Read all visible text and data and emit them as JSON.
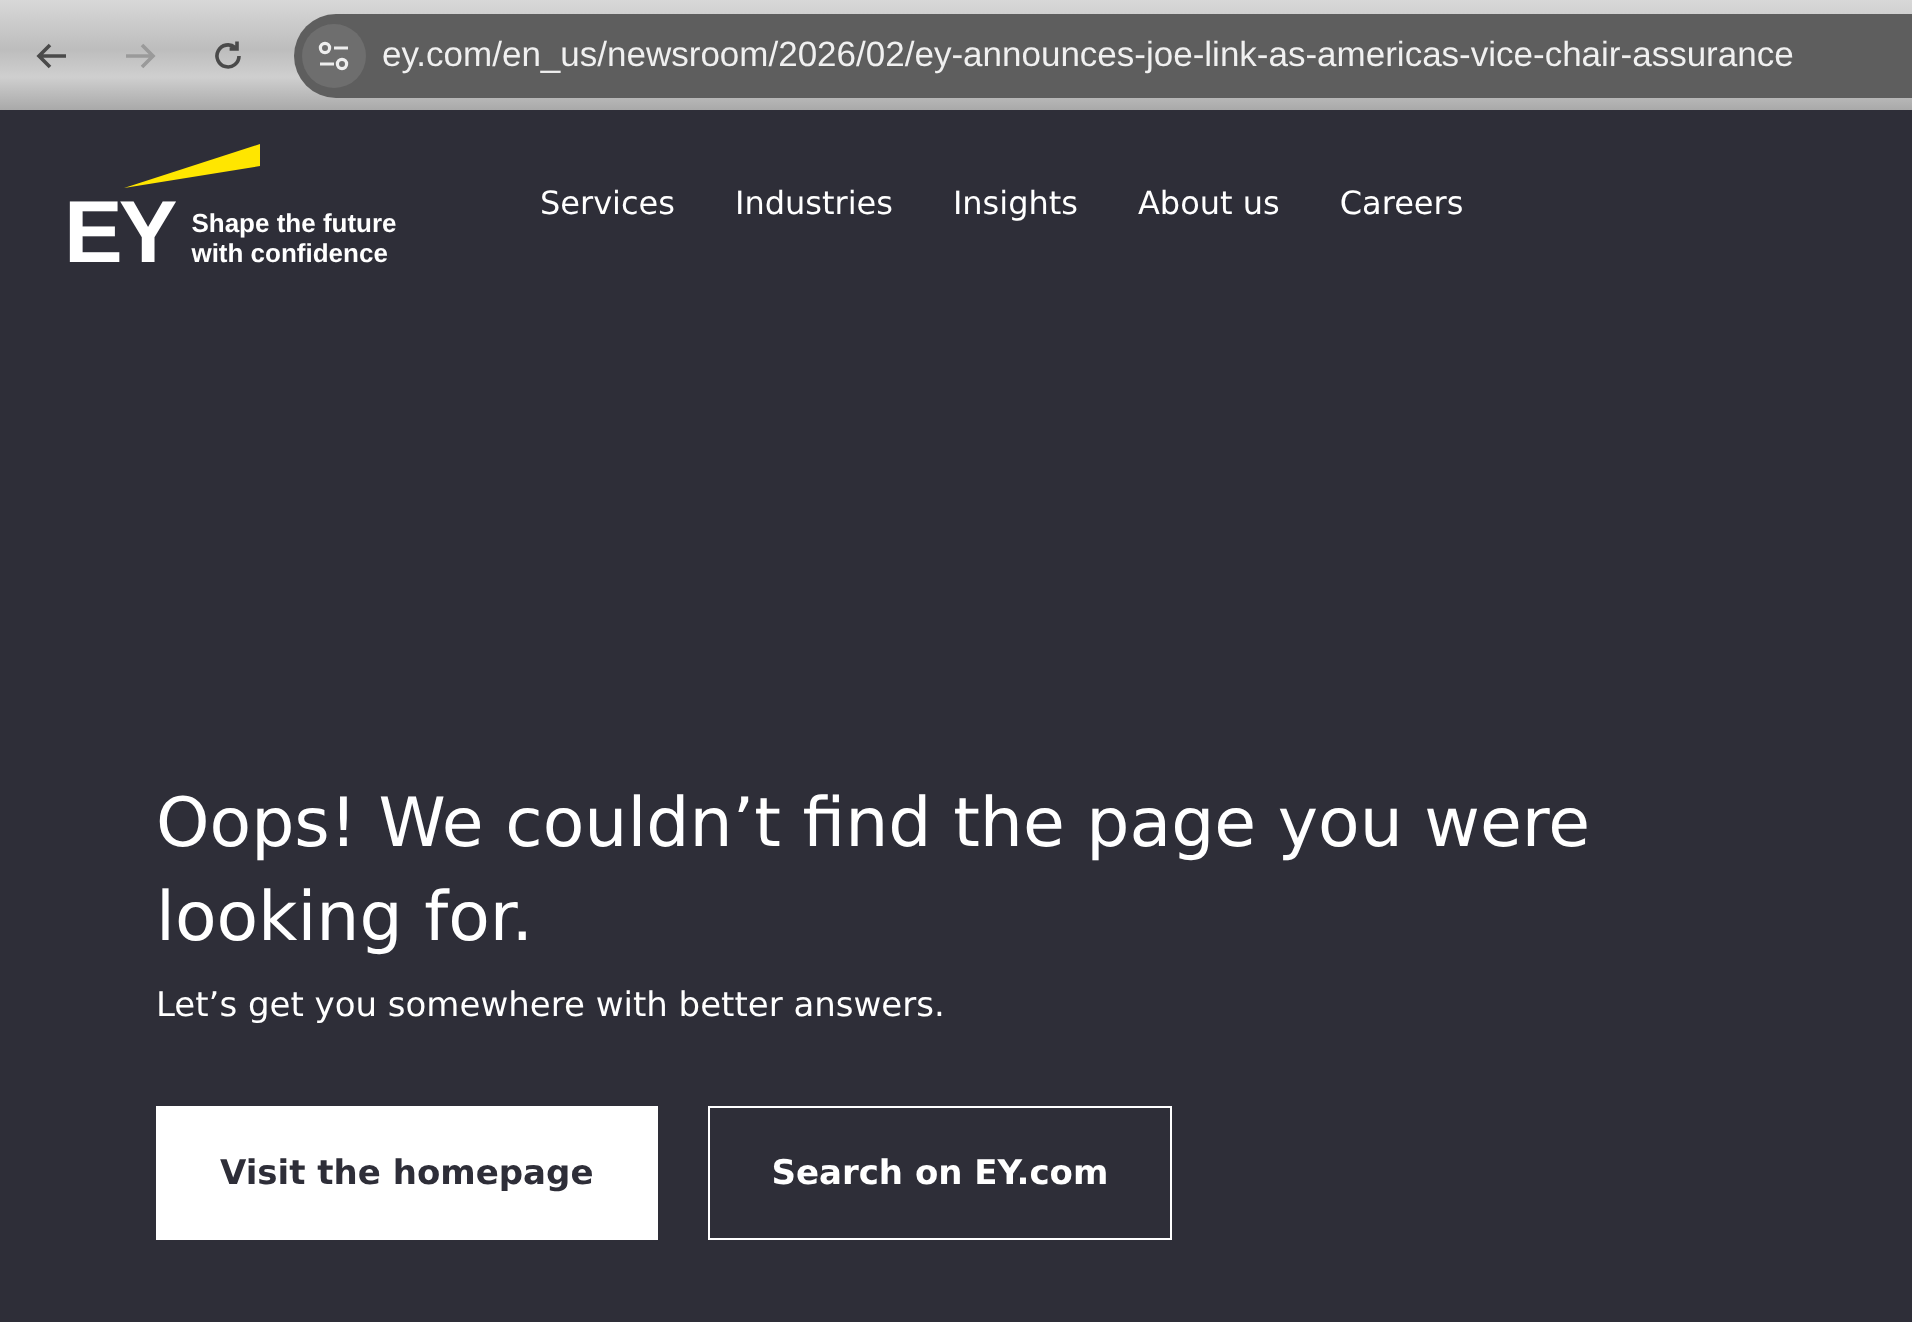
{
  "browser": {
    "url": "ey.com/en_us/newsroom/2026/02/ey-announces-joe-link-as-americas-vice-chair-assurance",
    "back_disabled": false,
    "forward_disabled": true
  },
  "header": {
    "logo": {
      "mark": "EY",
      "tagline_lines": [
        "Shape the future",
        "with confidence"
      ]
    },
    "nav": [
      {
        "label": "Services"
      },
      {
        "label": "Industries"
      },
      {
        "label": "Insights"
      },
      {
        "label": "About us"
      },
      {
        "label": "Careers"
      }
    ]
  },
  "error": {
    "title": "Oops! We couldn’t find the page you were looking for.",
    "subtitle": "Let’s get you somewhere with better answers.",
    "buttons": [
      {
        "label": "Visit the homepage",
        "kind": "primary"
      },
      {
        "label": "Search on EY.com",
        "kind": "outline"
      }
    ]
  }
}
